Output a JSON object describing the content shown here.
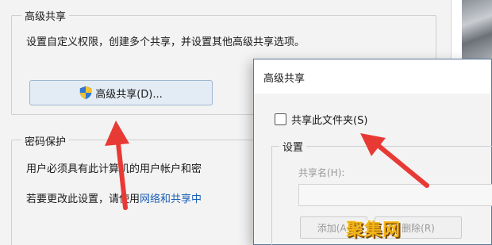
{
  "background_window": {
    "advanced_sharing_group": {
      "title": "高级共享",
      "description": "设置自定义权限，创建多个共享，并设置其他高级共享选项。",
      "button_label": "高级共享(D)..."
    },
    "password_protection_group": {
      "title": "密码保护",
      "user_text": "用户必须具有此计算机的用户帐户和密",
      "change_text": "若要更改此设置，请使用",
      "link_text": "网络和共享中"
    }
  },
  "dialog": {
    "title": "高级共享",
    "share_checkbox_label": "共享此文件夹(S)",
    "share_checkbox_checked": false,
    "settings_title": "设置",
    "share_name_label": "共享名(H):",
    "share_name_value": "",
    "add_button": "添加(A)",
    "remove_button": "删除(R)"
  },
  "annotations": {
    "arrow_color": "#e83a35"
  },
  "watermark": "聚集网"
}
